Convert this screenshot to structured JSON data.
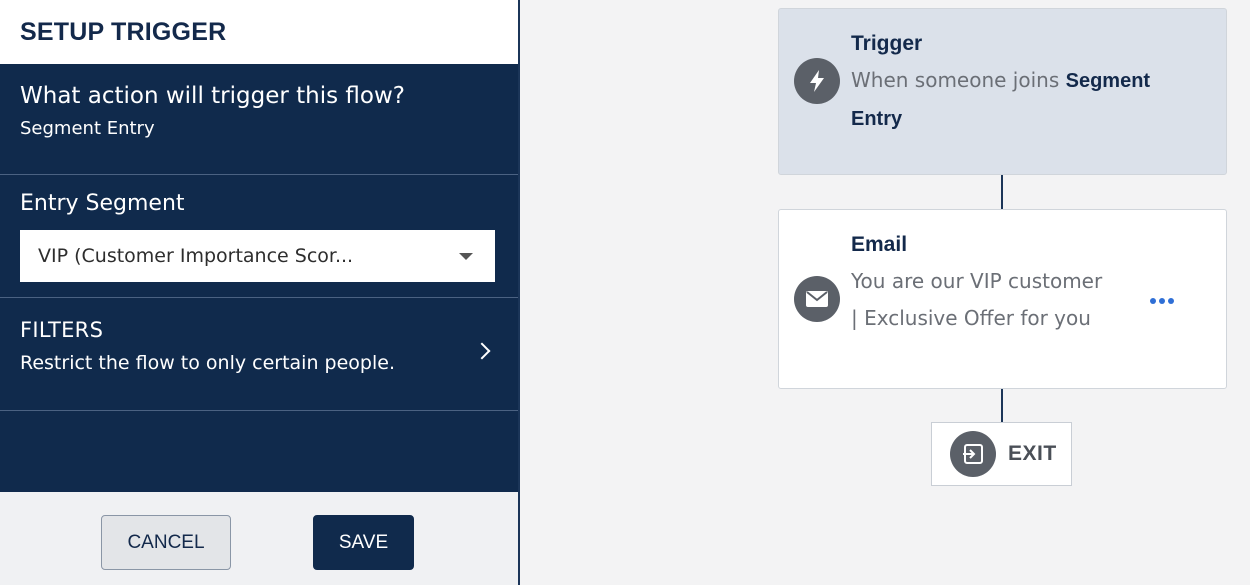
{
  "panel": {
    "title": "SETUP TRIGGER",
    "trigger_question": "What action will trigger this flow?",
    "trigger_value": "Segment Entry",
    "entry_segment_label": "Entry Segment",
    "entry_segment_value": "VIP (Customer Importance Scor...",
    "filters_label": "FILTERS",
    "filters_desc": "Restrict the flow to only certain people.",
    "cancel_label": "CANCEL",
    "save_label": "SAVE"
  },
  "flow": {
    "trigger_node": {
      "title": "Trigger",
      "desc_prefix": "When someone joins ",
      "desc_bold": "Segment Entry",
      "icon": "lightning-icon"
    },
    "email_node": {
      "title": "Email",
      "subject": "You are our VIP customer | Exclusive Offer for you",
      "icon": "envelope-icon",
      "menu_icon": "more-horizontal-icon"
    },
    "exit_node": {
      "label": "EXIT",
      "icon": "exit-icon"
    }
  },
  "colors": {
    "navy": "#102a4c",
    "accent_blue": "#2f6fd6",
    "trigger_node_bg": "#dbe1ea",
    "icon_gray": "#5b6068"
  }
}
